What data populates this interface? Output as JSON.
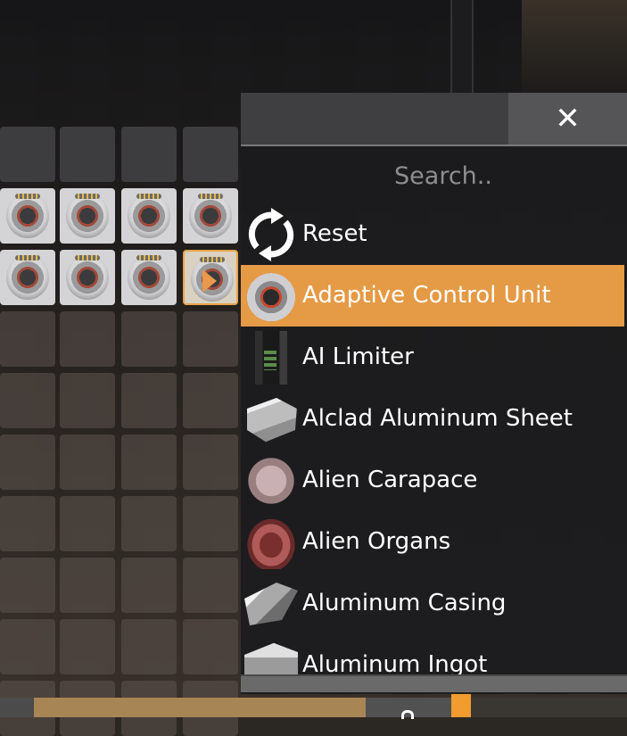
{
  "search": {
    "placeholder": "Search.."
  },
  "close": {
    "symbol": "✕"
  },
  "items": [
    {
      "label": "Reset",
      "icon": "reset-icon"
    },
    {
      "label": "Adaptive Control Unit",
      "icon": "adaptive-control-unit-icon",
      "selected": true
    },
    {
      "label": "AI Limiter",
      "icon": "ai-limiter-icon"
    },
    {
      "label": "Alclad Aluminum Sheet",
      "icon": "alclad-aluminum-sheet-icon"
    },
    {
      "label": "Alien Carapace",
      "icon": "alien-carapace-icon"
    },
    {
      "label": "Alien Organs",
      "icon": "alien-organs-icon"
    },
    {
      "label": "Aluminum Casing",
      "icon": "aluminum-casing-icon"
    },
    {
      "label": "Aluminum Ingot",
      "icon": "aluminum-ingot-icon"
    }
  ],
  "colors": {
    "highlight": "#e59a46",
    "accent": "#f29b2e",
    "panel": "#1c1c1e"
  },
  "inventory": {
    "item": "Adaptive Control Unit",
    "filled_slots": 8
  }
}
